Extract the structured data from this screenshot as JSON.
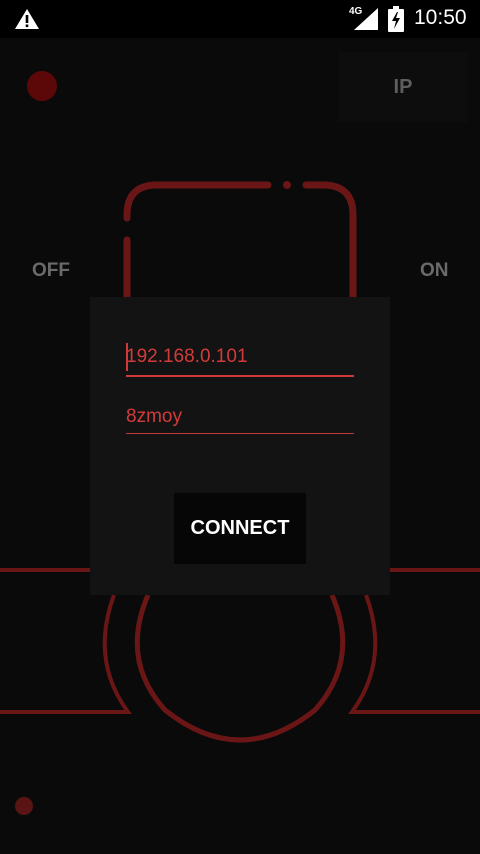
{
  "status_bar": {
    "network": "4G",
    "time": "10:50",
    "icons": [
      "warning-icon",
      "signal-icon",
      "battery-charging-icon"
    ]
  },
  "controls": {
    "ip_button_label": "IP",
    "off_label": "OFF",
    "on_label": "ON"
  },
  "dialog": {
    "ip_value": "192.168.0.101",
    "password_value": "8zmoy",
    "connect_label": "CONNECT"
  },
  "colors": {
    "accent": "#d03a3a",
    "background": "#0a0a0a",
    "dialog": "#131313",
    "record_dot": "#5c0808"
  }
}
